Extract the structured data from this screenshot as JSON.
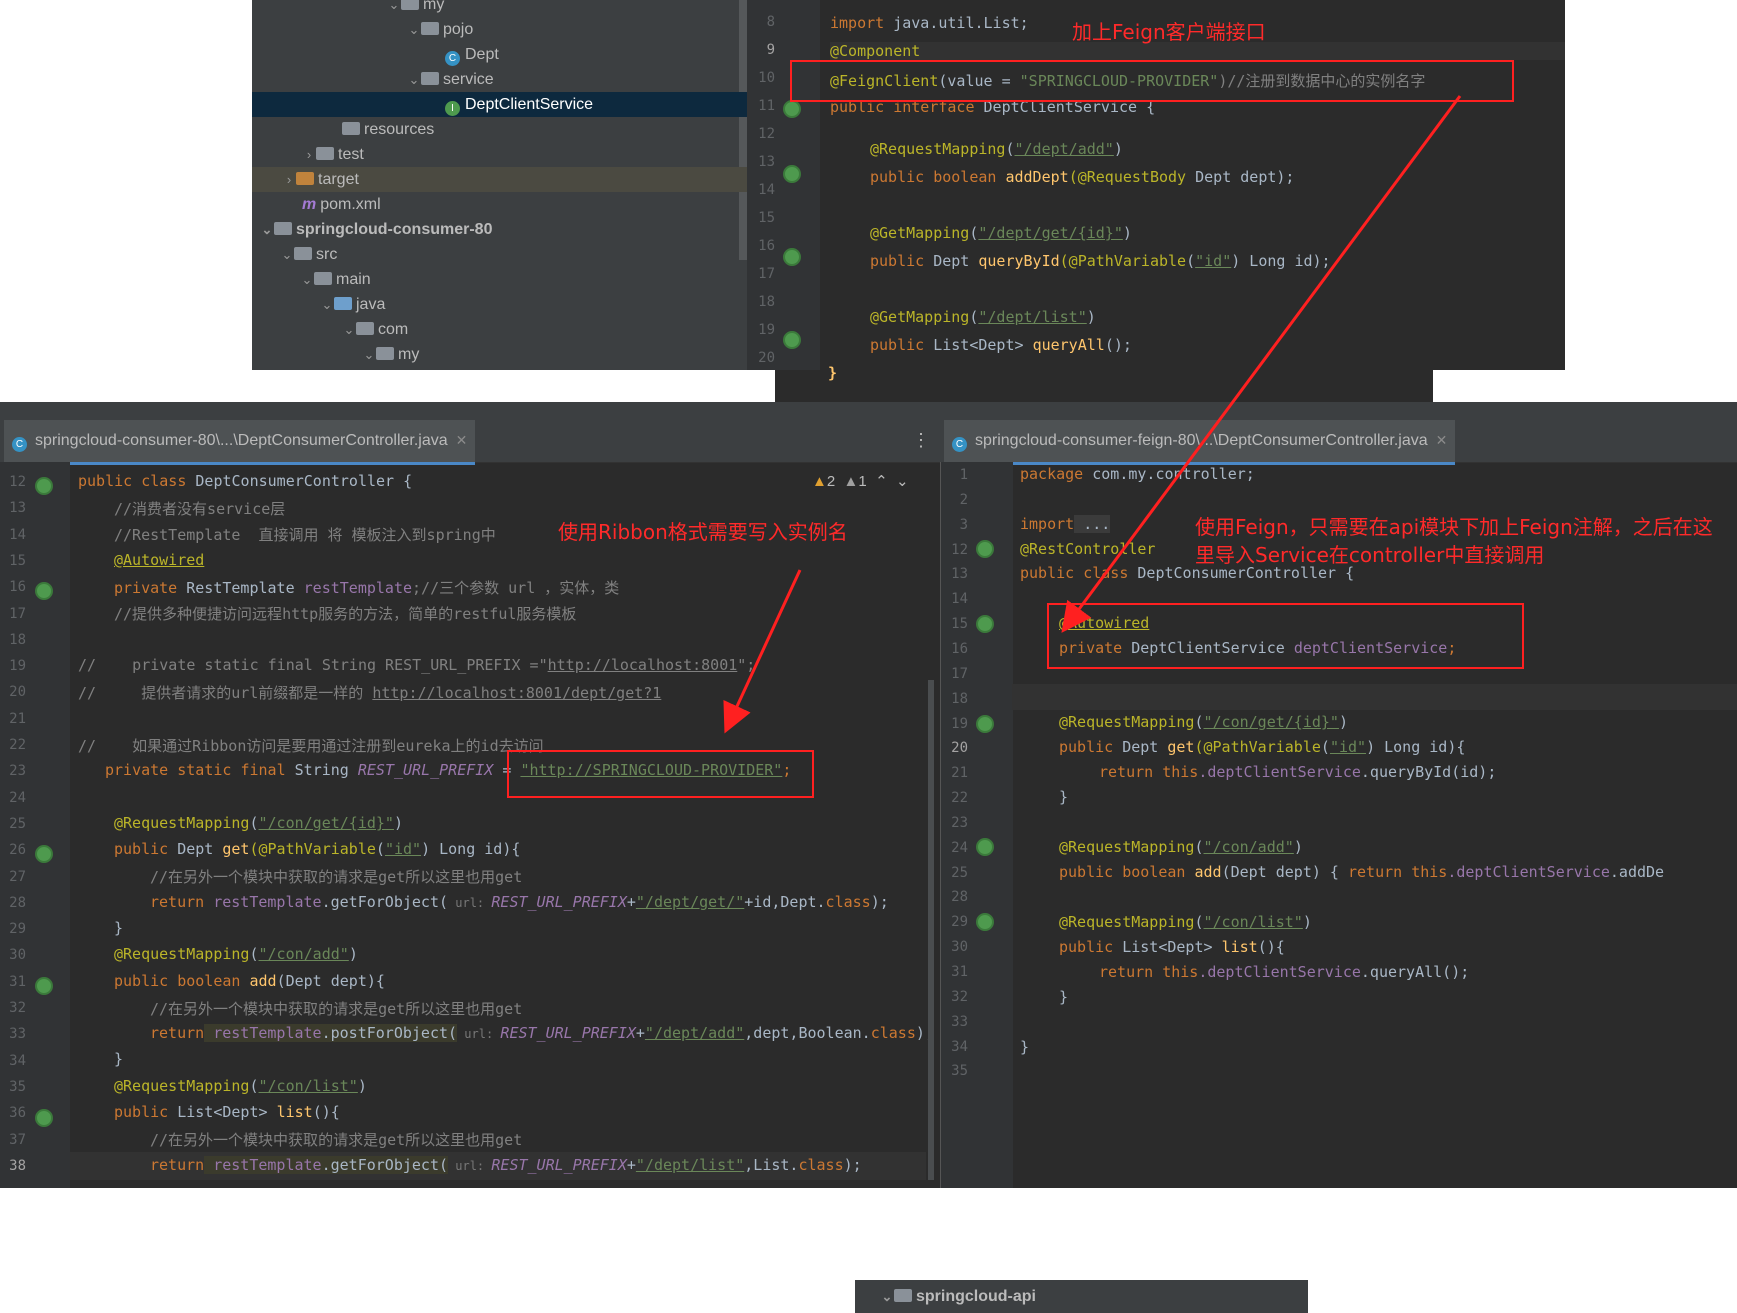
{
  "tree": {
    "rows": [
      {
        "label": "my",
        "arrow": "⌄",
        "icon": "package-folder-icon"
      },
      {
        "label": "pojo",
        "arrow": "⌄",
        "icon": "package-folder-icon"
      },
      {
        "label": "Dept",
        "arrow": "",
        "icon": "class-icon"
      },
      {
        "label": "service",
        "arrow": "⌄",
        "icon": "package-folder-icon"
      },
      {
        "label": "DeptClientService",
        "arrow": "",
        "icon": "interface-icon"
      },
      {
        "label": "resources",
        "arrow": "",
        "icon": "resources-folder-icon"
      },
      {
        "label": "test",
        "arrow": "›",
        "icon": "folder-icon"
      },
      {
        "label": "target",
        "arrow": "›",
        "icon": "orange-folder-icon"
      },
      {
        "label": "pom.xml",
        "arrow": "",
        "icon": "maven-icon"
      },
      {
        "label": "springcloud-consumer-80",
        "arrow": "⌄",
        "icon": "module-folder-icon"
      },
      {
        "label": "src",
        "arrow": "⌄",
        "icon": "folder-icon"
      },
      {
        "label": "main",
        "arrow": "⌄",
        "icon": "folder-icon"
      },
      {
        "label": "java",
        "arrow": "⌄",
        "icon": "source-folder-icon"
      },
      {
        "label": "com",
        "arrow": "⌄",
        "icon": "package-folder-icon"
      },
      {
        "label": "my",
        "arrow": "⌄",
        "icon": "package-folder-icon"
      }
    ]
  },
  "top_editor": {
    "line_numbers": [
      "8",
      "9",
      "10",
      "11",
      "12",
      "13",
      "14",
      "15",
      "16",
      "17",
      "18",
      "19",
      "20"
    ],
    "lines": {
      "l8_kw": "import",
      "l8_rest": " java.util.List;",
      "l9": "@Component",
      "l10_an": "@FeignClient",
      "l10_a": "(value = ",
      "l10_str": "\"SPRINGCLOUD-PROVIDER\"",
      "l10_cm": ")//注册到数据中心的实例名字",
      "l11_kw": "public interface",
      "l11_rest": " DeptClientService {",
      "l13_an": "@RequestMapping",
      "l13_a": "(",
      "l13_str": "\"/dept/add\"",
      "l13_b": ")",
      "l14_kw1": "public boolean",
      "l14_fn": " addDept",
      "l14_an": "(@RequestBody",
      "l14_rest": " Dept dept);",
      "l16_an": "@GetMapping",
      "l16_a": "(",
      "l16_str": "\"/dept/get/{id}\"",
      "l16_b": ")",
      "l17_kw": "public",
      "l17_rest": " Dept ",
      "l17_fn": "queryById",
      "l17_an": "(@PathVariable",
      "l17_a": "(",
      "l17_str": "\"id\"",
      "l17_b": ") Long id);",
      "l19_an": "@GetMapping",
      "l19_a": "(",
      "l19_str": "\"/dept/list\"",
      "l19_b": ")",
      "l20_kw": "public",
      "l20_rest": " List<Dept> ",
      "l20_fn": "queryAll",
      "l20_b": "();",
      "l21": "}"
    },
    "note": "加上Feign客户端接口"
  },
  "left_editor": {
    "tab": "springcloud-consumer-80\\...\\DeptConsumerController.java",
    "warnings": "2",
    "weak_warnings": "1",
    "line_numbers": [
      "12",
      "13",
      "14",
      "15",
      "16",
      "17",
      "18",
      "19",
      "20",
      "21",
      "22",
      "23",
      "24",
      "25",
      "26",
      "27",
      "28",
      "29",
      "30",
      "31",
      "32",
      "33",
      "34",
      "35",
      "36",
      "37",
      "38"
    ],
    "lines": {
      "l12_kw": "public class",
      "l12_rest": " DeptConsumerController {",
      "l13": "//消费者没有service层",
      "l14": "//RestTemplate  直接调用 将 模板注入到spring中",
      "l15": "@Autowired",
      "l16_kw": "private",
      "l16_rest": " RestTemplate ",
      "l16_fld": "restTemplate",
      "l16_cm": ";//三个参数 url ，实体，类",
      "l17": "//提供多种便捷访问远程http服务的方法，简单的restful服务模板",
      "l19_cm": "//    private static final String REST_URL_PREFIX =\"",
      "l19_url": "http://localhost:8001",
      "l19_end": "\";",
      "l20_cm": "//     提供者请求的url前缀都是一样的 ",
      "l20_url": "http://localhost:8001/dept/get?1",
      "l22": "//    如果通过Ribbon访问是要用通过注册到eureka上的id去访问",
      "l23_kw": "private static final",
      "l23_rest": " String ",
      "l23_fld": "REST_URL_PREFIX",
      "l23_eq": " = ",
      "l23_str": "\"http://SPRINGCLOUD-PROVIDER\"",
      "l23_end": ";",
      "l25_an": "@RequestMapping",
      "l25_a": "(",
      "l25_str": "\"/con/get/{id}\"",
      "l25_b": ")",
      "l26_kw": "public",
      "l26_rest": " Dept ",
      "l26_fn": "get",
      "l26_an": "(@PathVariable",
      "l26_a": "(",
      "l26_str": "\"id\"",
      "l26_b": ") Long id){",
      "l27": "//在另外一个模块中获取的请求是get所以这里也用get",
      "l28_kw": "return",
      "l28_fld": " restTemplate",
      "l28_a": ".getForObject(",
      "l28_hint": " url: ",
      "l28_it": "REST_URL_PREFIX",
      "l28_p": "+",
      "l28_str": "\"/dept/get/\"",
      "l28_b": "+id,Dept.",
      "l28_kw2": "class",
      "l28_c": ");",
      "l29": "}",
      "l30_an": "@RequestMapping",
      "l30_a": "(",
      "l30_str": "\"/con/add\"",
      "l30_b": ")",
      "l31_kw": "public boolean",
      "l31_fn": " add",
      "l31_b": "(Dept dept){",
      "l32": "//在另外一个模块中获取的请求是get所以这里也用get",
      "l33_kw": "return",
      "l33_fld": " restTemplate",
      "l33_a": ".postForObject(",
      "l33_hint": " url: ",
      "l33_it": "REST_URL_PREFIX",
      "l33_p": "+",
      "l33_str": "\"/dept/add\"",
      "l33_b": ",dept,Boolean.",
      "l33_kw2": "class",
      "l33_c": ");",
      "l34": "}",
      "l35_an": "@RequestMapping",
      "l35_a": "(",
      "l35_str": "\"/con/list\"",
      "l35_b": ")",
      "l36_kw": "public",
      "l36_rest": " List<Dept> ",
      "l36_fn": "list",
      "l36_b": "(){",
      "l37": "//在另外一个模块中获取的请求是get所以这里也用get",
      "l38_kw": "return",
      "l38_fld": " restTemplate",
      "l38_a": ".getForObject(",
      "l38_hint": " url: ",
      "l38_it": "REST_URL_PREFIX",
      "l38_p": "+",
      "l38_str": "\"/dept/list\"",
      "l38_b": ",List.",
      "l38_kw2": "class",
      "l38_c": ");"
    },
    "note": "使用Ribbon格式需要写入实例名"
  },
  "right_editor": {
    "tab": "springcloud-consumer-feign-80\\...\\DeptConsumerController.java",
    "line_numbers": [
      "1",
      "2",
      "3",
      "12",
      "13",
      "14",
      "15",
      "16",
      "17",
      "18",
      "19",
      "20",
      "21",
      "22",
      "23",
      "24",
      "25",
      "28",
      "29",
      "30",
      "31",
      "32",
      "33",
      "34",
      "35"
    ],
    "lines": {
      "l1_kw": "package",
      "l1_rest": " com.my.controller;",
      "l3_kw": "import",
      "l3_rest": " ...",
      "l12": "@RestController",
      "l13_kw": "public class",
      "l13_rest": " DeptConsumerController {",
      "l15": "@Autowired",
      "l16_kw": "private",
      "l16_rest": " DeptClientService ",
      "l16_fld": "deptClientService",
      "l16_end": ";",
      "l19_an": "@RequestMapping",
      "l19_a": "(",
      "l19_str": "\"/con/get/{id}\"",
      "l19_b": ")",
      "l20_kw": "public",
      "l20_rest": " Dept ",
      "l20_fn": "get",
      "l20_an": "(@PathVariable",
      "l20_a": "(",
      "l20_str": "\"id\"",
      "l20_b": ") Long id){",
      "l21_kw": "return this",
      "l21_fld": ".deptClientService",
      "l21_b": ".queryById(id);",
      "l22": "}",
      "l24_an": "@RequestMapping",
      "l24_a": "(",
      "l24_str": "\"/con/add\"",
      "l24_b": ")",
      "l25_kw": "public boolean",
      "l25_fn": " add",
      "l25_b": "(Dept dept) { ",
      "l25_kw2": "return this",
      "l25_fld": ".deptClientService",
      "l25_c": ".addDe",
      "l29_an": "@RequestMapping",
      "l29_a": "(",
      "l29_str": "\"/con/list\"",
      "l29_b": ")",
      "l30_kw": "public",
      "l30_rest": " List<Dept> ",
      "l30_fn": "list",
      "l30_b": "(){",
      "l31_kw": "return this",
      "l31_fld": ".deptClientService",
      "l31_b": ".queryAll();",
      "l32": "}",
      "l34": "}"
    },
    "note": "使用Feign，只需要在api模块下加上Feign注解，之后在这里导入Service在controller中直接调用"
  },
  "bottom": {
    "label": "springcloud-api"
  },
  "colors": {
    "annotation_red": "#ff2020",
    "editor_bg": "#2b2b2b",
    "keyword": "#cc7832",
    "string": "#6a8759"
  }
}
